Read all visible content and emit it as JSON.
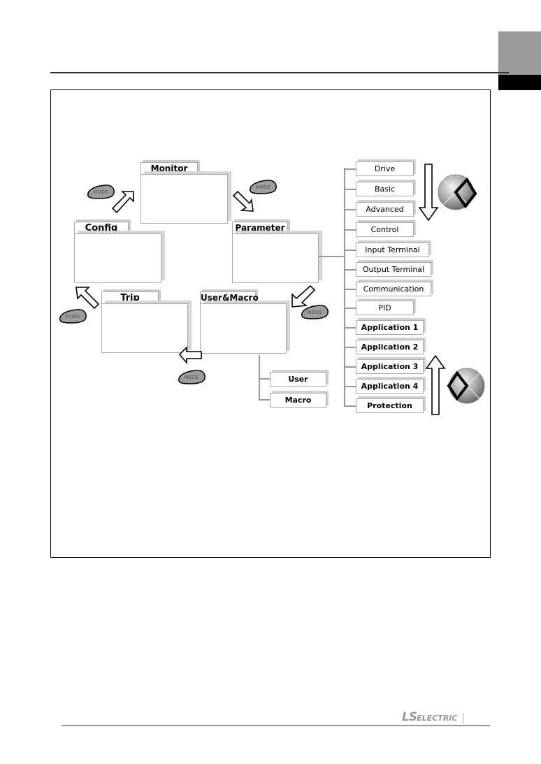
{
  "diagram": {
    "folders": {
      "monitor": "Monitor",
      "config": "Config",
      "parameter": "Parameter",
      "trip": "Trip",
      "user_macro": "User&Macro"
    },
    "mode_key_label": "MODE",
    "parameter_groups": [
      "Drive",
      "Basic",
      "Advanced",
      "Control",
      "Input Terminal",
      "Output Terminal",
      "Communication",
      "PID",
      "Application 1",
      "Application 2",
      "Application 3",
      "Application 4",
      "Protection"
    ],
    "user_macro_groups": [
      "User",
      "Macro"
    ]
  },
  "footer": {
    "brand_ls": "LS",
    "brand_electric": "ELECTRIC"
  },
  "colors": {
    "tab_gray": "#9a9a9a",
    "tab_black": "#000000",
    "border": "#aaaaaa"
  }
}
